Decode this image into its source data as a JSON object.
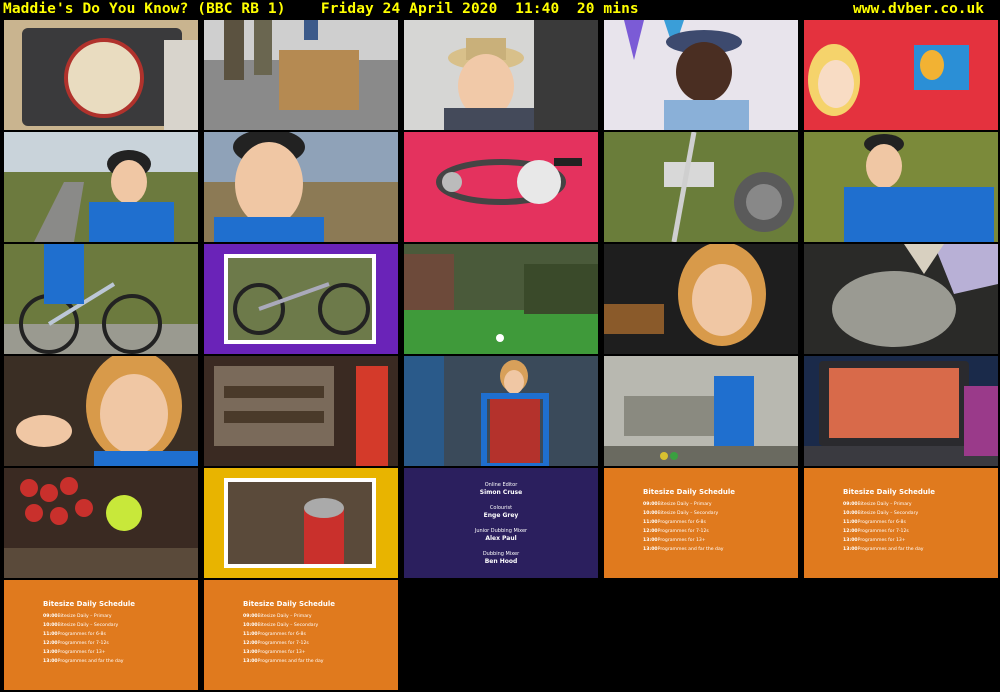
{
  "header": {
    "title": "Maddie's Do You Know? (BBC RB 1)    Friday 24 April 2020  11:40  20 mins",
    "site": "www.dvber.co.uk"
  },
  "credits": [
    {
      "role": "Online Editor",
      "name": "Simon Cruse"
    },
    {
      "role": "Colourist",
      "name": "Enge Grey"
    },
    {
      "role": "Junior Dubbing Mixer",
      "name": "Alex Paul"
    },
    {
      "role": "Dubbing Mixer",
      "name": "Ben Hood"
    }
  ],
  "schedule": {
    "title": "Bitesize Daily Schedule",
    "rows": [
      {
        "time": "09:00",
        "label": "Bitesize Daily – Primary"
      },
      {
        "time": "10:00",
        "label": "Bitesize Daily – Secondary"
      },
      {
        "time": "11:00",
        "label": "Programmes for 6-8s"
      },
      {
        "time": "12:00",
        "label": "Programmes for 7-12s"
      },
      {
        "time": "13:00",
        "label": "Programmes for 13+"
      },
      {
        "time": "13:00",
        "label": "Programmes and far the day"
      }
    ]
  },
  "colors": {
    "header_text": "#ffff00",
    "schedule_orange": "#e07a1e",
    "credits_purple": "#2b1f5e"
  }
}
